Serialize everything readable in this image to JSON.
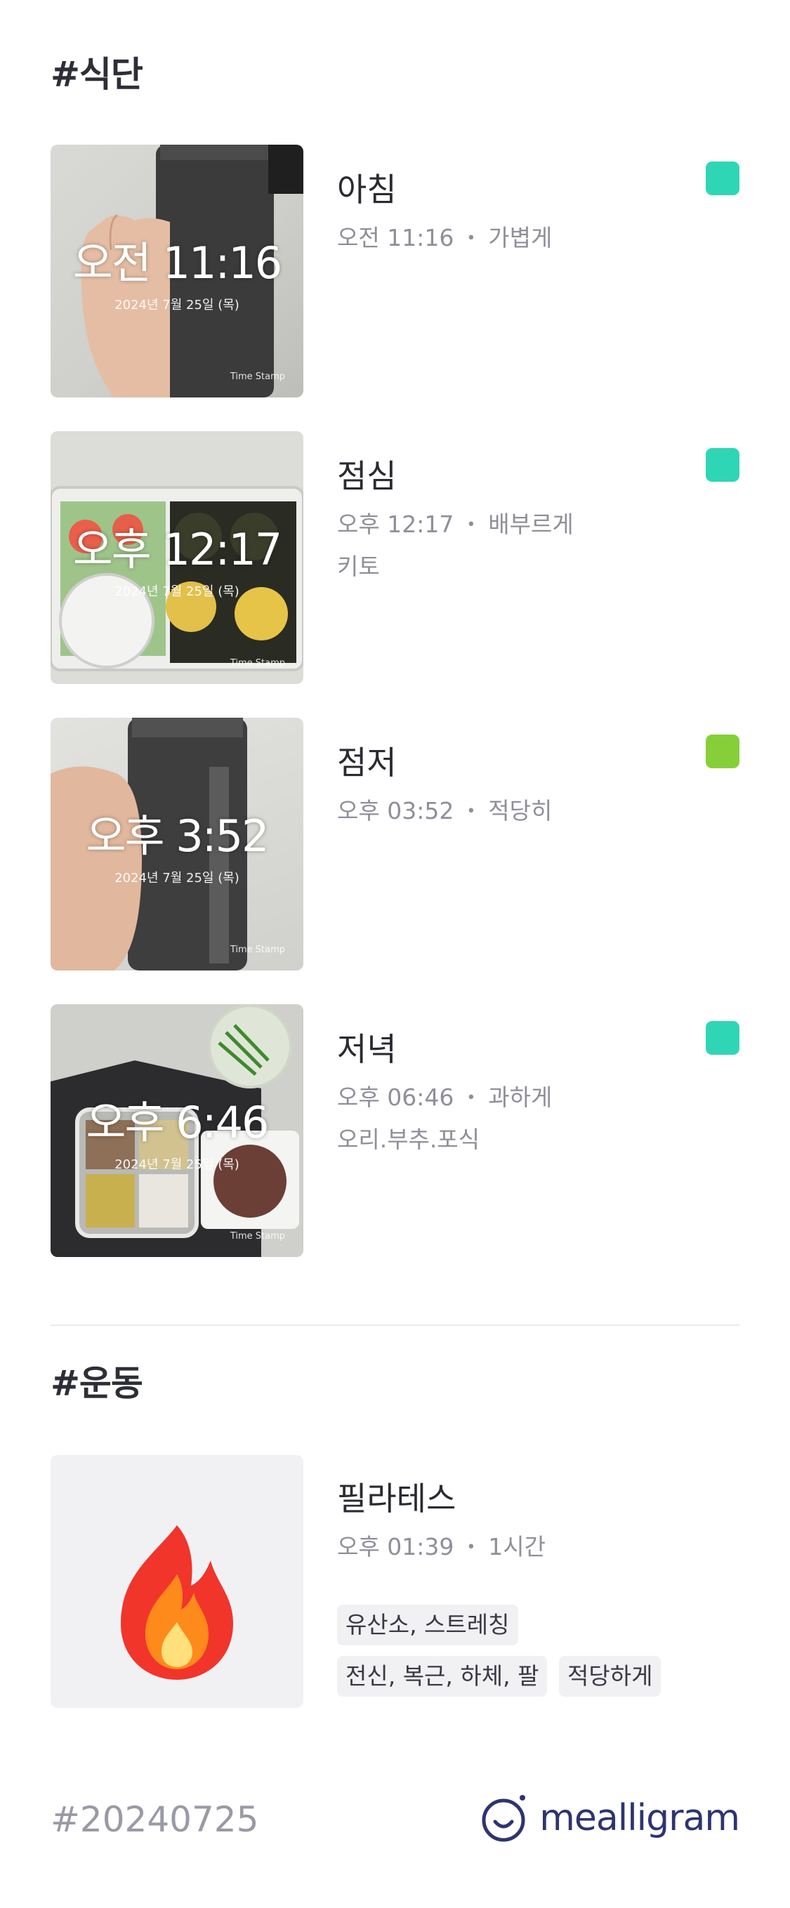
{
  "meals_section": {
    "title": "#식단"
  },
  "meals": [
    {
      "name": "아침",
      "time": "오전 11:16",
      "amount": "가볍게",
      "note": "",
      "indicator_color": "#2fd6b5",
      "photo": {
        "overlay_time": "오전 11:16",
        "overlay_date": "2024년 7월 25일 (목)",
        "brand": "Time Stamp"
      }
    },
    {
      "name": "점심",
      "time": "오후 12:17",
      "amount": "배부르게",
      "note": "키토",
      "indicator_color": "#2fd6b5",
      "photo": {
        "overlay_time": "오후 12:17",
        "overlay_date": "2024년 7월 25일 (목)",
        "brand": "Time Stamp"
      }
    },
    {
      "name": "점저",
      "time": "오후 03:52",
      "amount": "적당히",
      "note": "",
      "indicator_color": "#86cf38",
      "photo": {
        "overlay_time": "오후 3:52",
        "overlay_date": "2024년 7월 25일 (목)",
        "brand": "Time Stamp"
      }
    },
    {
      "name": "저녁",
      "time": "오후 06:46",
      "amount": "과하게",
      "note": "오리.부추.포식",
      "indicator_color": "#2fd6b5",
      "photo": {
        "overlay_time": "오후 6:46",
        "overlay_date": "2024년 7월 25일 (목)",
        "brand": "Time Stamp"
      }
    }
  ],
  "exercise_section": {
    "title": "#운동"
  },
  "exercise": {
    "icon": "fire-icon",
    "name": "필라테스",
    "time": "오후 01:39",
    "duration": "1시간",
    "tags": [
      "유산소, 스트레칭",
      "전신, 복근, 하체, 팔",
      "적당하게"
    ]
  },
  "footer": {
    "date_tag": "#20240725",
    "brand": "mealligram",
    "brand_color": "#2e3470"
  },
  "separator": "•"
}
